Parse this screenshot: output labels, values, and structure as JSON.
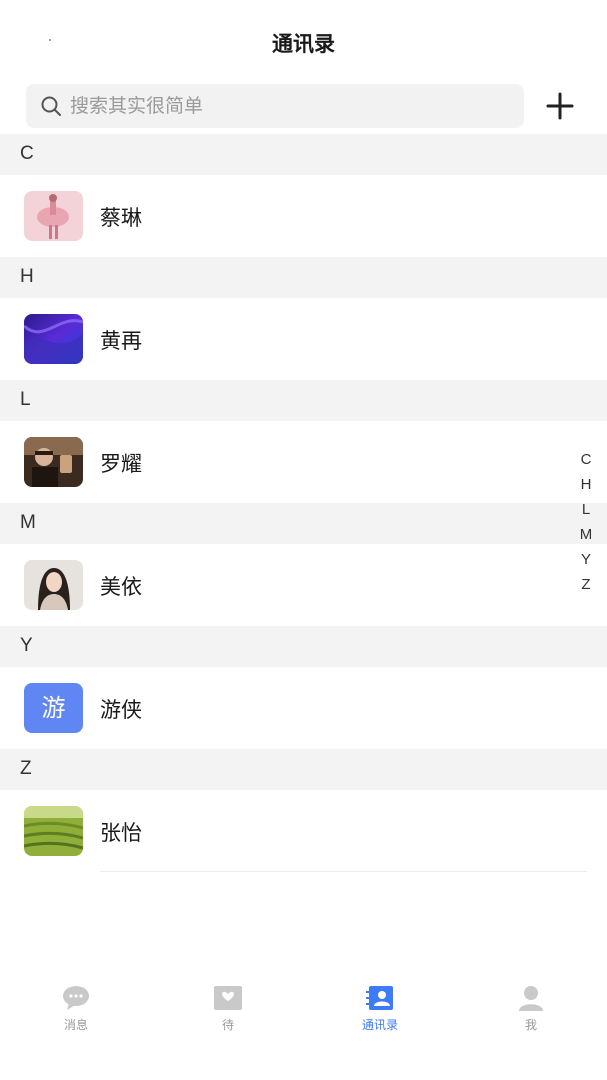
{
  "header": {
    "title": "通讯录"
  },
  "search": {
    "placeholder": "搜索其实很简单"
  },
  "sections": [
    {
      "letter": "C",
      "contacts": [
        {
          "name": "蔡琳",
          "avatar": "photo"
        }
      ]
    },
    {
      "letter": "H",
      "contacts": [
        {
          "name": "黄再",
          "avatar": "photo"
        }
      ]
    },
    {
      "letter": "L",
      "contacts": [
        {
          "name": "罗耀",
          "avatar": "photo"
        }
      ]
    },
    {
      "letter": "M",
      "contacts": [
        {
          "name": "美依",
          "avatar": "photo"
        }
      ]
    },
    {
      "letter": "Y",
      "contacts": [
        {
          "name": "游侠",
          "avatar": "text",
          "avatar_text": "游"
        }
      ]
    },
    {
      "letter": "Z",
      "contacts": [
        {
          "name": "张怡",
          "avatar": "photo"
        }
      ]
    }
  ],
  "index_bar": [
    "C",
    "H",
    "L",
    "M",
    "Y",
    "Z"
  ],
  "tabbar": {
    "tabs": [
      {
        "label": "消息",
        "icon": "chat-bubble-icon",
        "active": false
      },
      {
        "label": "待",
        "icon": "inbox-icon",
        "active": false
      },
      {
        "label": "通讯录",
        "icon": "contacts-icon",
        "active": true
      },
      {
        "label": "我",
        "icon": "person-icon",
        "active": false
      }
    ]
  },
  "colors": {
    "accent": "#3e7bf7",
    "section_bg": "#f3f3f3",
    "search_bg": "#f2f2f2",
    "text_avatar_bg": "#5f86f2",
    "inactive_tab": "#9a9a9a"
  }
}
